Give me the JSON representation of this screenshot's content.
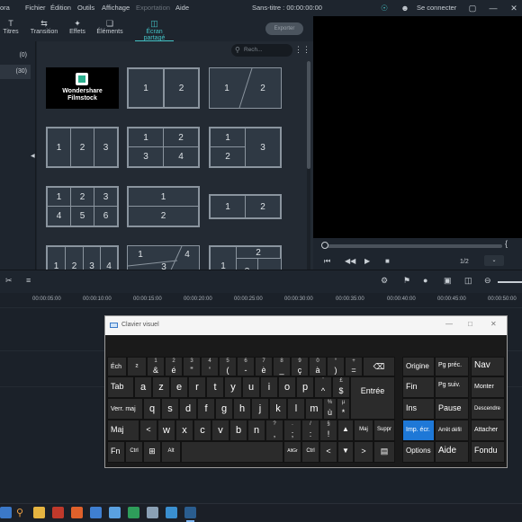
{
  "menubar": {
    "app_fragment": "ora",
    "items": [
      "Fichier",
      "Édition",
      "Outils",
      "Affichage",
      "Exportation",
      "Aide"
    ],
    "disabled_index": 4,
    "project_title": "Sans-titre : 00:00:00:00",
    "signin": "Se connecter",
    "icons": [
      "headphones-icon",
      "user-icon",
      "save-icon",
      "minimize-icon",
      "close-icon"
    ]
  },
  "tabs": {
    "items": [
      "Titres",
      "Transition",
      "Effets",
      "Éléments",
      "Écran partagé"
    ],
    "active_index": 4,
    "export_label": "Exporter"
  },
  "sidebar": {
    "rows": [
      "(0)",
      "(30)"
    ],
    "selected_index": 1
  },
  "library": {
    "search_placeholder": "Rech...",
    "logo_line1": "Wondershare",
    "logo_line2": "Filmstock",
    "layouts": [
      [
        "1",
        "2"
      ],
      [
        "1",
        "2"
      ],
      [
        "1",
        "2",
        "3"
      ],
      [
        "1",
        "2",
        "3",
        "4"
      ],
      [
        "1",
        "2",
        "3"
      ],
      [
        "1",
        "2",
        "3",
        "4",
        "5",
        "6"
      ],
      [
        "1",
        "2"
      ],
      [
        "1",
        "2"
      ],
      [
        "1",
        "2",
        "3",
        "4"
      ],
      [
        "1",
        "3",
        "4"
      ],
      [
        "1",
        "2",
        "3"
      ]
    ]
  },
  "preview": {
    "page": "1/2",
    "brace": "{"
  },
  "ruler": {
    "ticks": [
      "00:00:05:00",
      "00:00:10:00",
      "00:00:15:00",
      "00:00:20:00",
      "00:00:25:00",
      "00:00:30:00",
      "00:00:35:00",
      "00:00:40:00",
      "00:00:45:00",
      "00:00:50:00"
    ]
  },
  "osk": {
    "title": "Clavier visuel",
    "keys": {
      "ech": "Éch",
      "sup2": "²",
      "r1": [
        [
          "&",
          "1"
        ],
        [
          "é",
          "2"
        ],
        [
          "\"",
          "3"
        ],
        [
          "'",
          "4"
        ],
        [
          "(",
          "5"
        ],
        [
          "-",
          "6"
        ],
        [
          "è",
          "7"
        ],
        [
          "_",
          "8"
        ],
        [
          "ç",
          "9"
        ],
        [
          "à",
          "0"
        ],
        [
          ")",
          "°"
        ],
        [
          "=",
          "+"
        ]
      ],
      "backspace": "⌫",
      "tab": "Tab",
      "r2": [
        "a",
        "z",
        "e",
        "r",
        "t",
        "y",
        "u",
        "i",
        "o",
        "p"
      ],
      "r2b": [
        [
          "^",
          "¨"
        ],
        [
          "$",
          "£"
        ]
      ],
      "entree": "Entrée",
      "vermaj": "Verr. maj",
      "r3": [
        "q",
        "s",
        "d",
        "f",
        "g",
        "h",
        "j",
        "k",
        "l",
        "m"
      ],
      "r3b": [
        [
          "ù",
          "%"
        ],
        [
          "*",
          "µ"
        ]
      ],
      "maj": "Maj",
      "r4": [
        "w",
        "x",
        "c",
        "v",
        "b",
        "n"
      ],
      "r4b": [
        [
          ",",
          "?"
        ],
        [
          ";",
          "."
        ],
        [
          ":",
          "/"
        ],
        [
          "!",
          "§"
        ]
      ],
      "up": "▲",
      "maj2": "Maj",
      "suppr": "Suppr",
      "fn": "Fn",
      "ctrl": "Ctrl",
      "win": "⊞",
      "alt": "Alt",
      "altgr": "AltGr",
      "ctrl2": "Ctrl",
      "left": "<",
      "down": "▼",
      "right": ">",
      "menu": "▤",
      "nav": [
        [
          "Origine",
          "Pg préc.",
          "Nav"
        ],
        [
          "Fin",
          "Pg suiv.",
          "Monter"
        ],
        [
          "Ins",
          "Pause",
          "Descendre"
        ],
        [
          "Imp. écr.",
          "Arrêt défil",
          "Attacher"
        ],
        [
          "Options",
          "Aide",
          "Fondu"
        ]
      ]
    }
  },
  "colors": {
    "accent": "#44c4c7",
    "osk_highlight": "#1e78d7"
  }
}
